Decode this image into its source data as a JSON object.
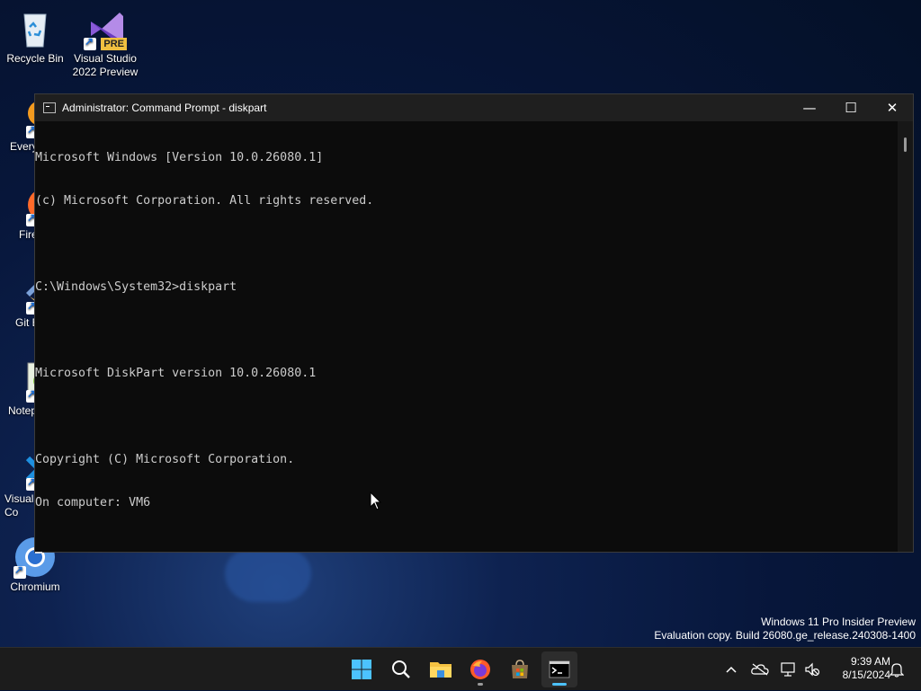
{
  "desktop": {
    "icons": [
      {
        "label": "Recycle Bin"
      },
      {
        "label": "Visual Studio 2022 Preview",
        "badge": "PRE"
      },
      {
        "label": "Every"
      },
      {
        "label": "Fire"
      },
      {
        "label": "Git E"
      },
      {
        "label": "Notep"
      },
      {
        "label": "Visual Co"
      },
      {
        "label": "Chromium"
      }
    ],
    "watermark": {
      "line1": "Windows 11 Pro Insider Preview",
      "line2": "Evaluation copy. Build 26080.ge_release.240308-1400"
    }
  },
  "window": {
    "title": "Administrator: Command Prompt - diskpart",
    "controls": {
      "minimize": "—",
      "maximize": "☐",
      "close": "✕"
    },
    "lines": [
      "Microsoft Windows [Version 10.0.26080.1]",
      "(c) Microsoft Corporation. All rights reserved.",
      "",
      "C:\\Windows\\System32>diskpart",
      "",
      "Microsoft DiskPart version 10.0.26080.1",
      "",
      "Copyright (C) Microsoft Corporation.",
      "On computer: VM6"
    ]
  },
  "taskbar": {
    "apps": [
      {
        "name": "Start",
        "icon": "windows-logo-icon"
      },
      {
        "name": "Search",
        "icon": "search-icon"
      },
      {
        "name": "File Explorer",
        "icon": "folder-icon"
      },
      {
        "name": "Firefox",
        "icon": "firefox-icon"
      },
      {
        "name": "Store",
        "icon": "store-icon"
      },
      {
        "name": "Command Prompt",
        "icon": "terminal-icon"
      }
    ],
    "clock": {
      "time": "9:39 AM",
      "date": "8/15/2024"
    }
  },
  "colors": {
    "accent": "#4cc2ff",
    "console_bg": "#0c0c0c",
    "console_text": "#cccccc",
    "taskbar_bg": "#1c1c1c"
  }
}
